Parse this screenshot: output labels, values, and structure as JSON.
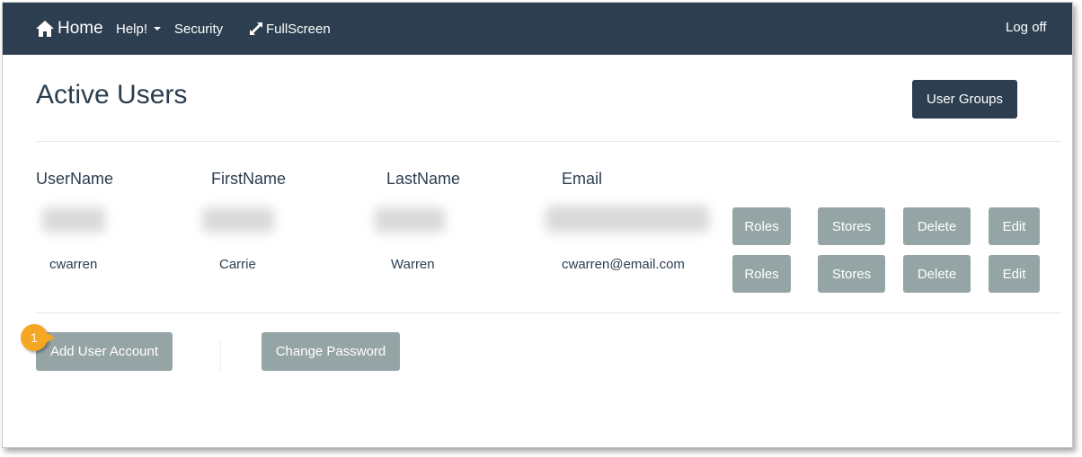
{
  "nav": {
    "home": "Home",
    "help": "Help!",
    "security": "Security",
    "fullscreen": "FullScreen",
    "logoff": "Log off"
  },
  "page": {
    "title": "Active Users",
    "user_groups_button": "User Groups"
  },
  "table": {
    "headers": [
      "UserName",
      "FirstName",
      "LastName",
      "Email"
    ],
    "row": {
      "username": "cwarren",
      "firstname": "Carrie",
      "lastname": "Warren",
      "email": "cwarren@email.com"
    },
    "actions": [
      "Roles",
      "Stores",
      "Delete",
      "Edit"
    ]
  },
  "footer": {
    "add_user": "Add User Account",
    "change_password": "Change Password"
  },
  "callout": {
    "number": "1"
  },
  "colors": {
    "navbar": "#2c3e50",
    "primary_button": "#2c3e50",
    "secondary_button": "#95a5a6",
    "callout": "#f5a623"
  }
}
